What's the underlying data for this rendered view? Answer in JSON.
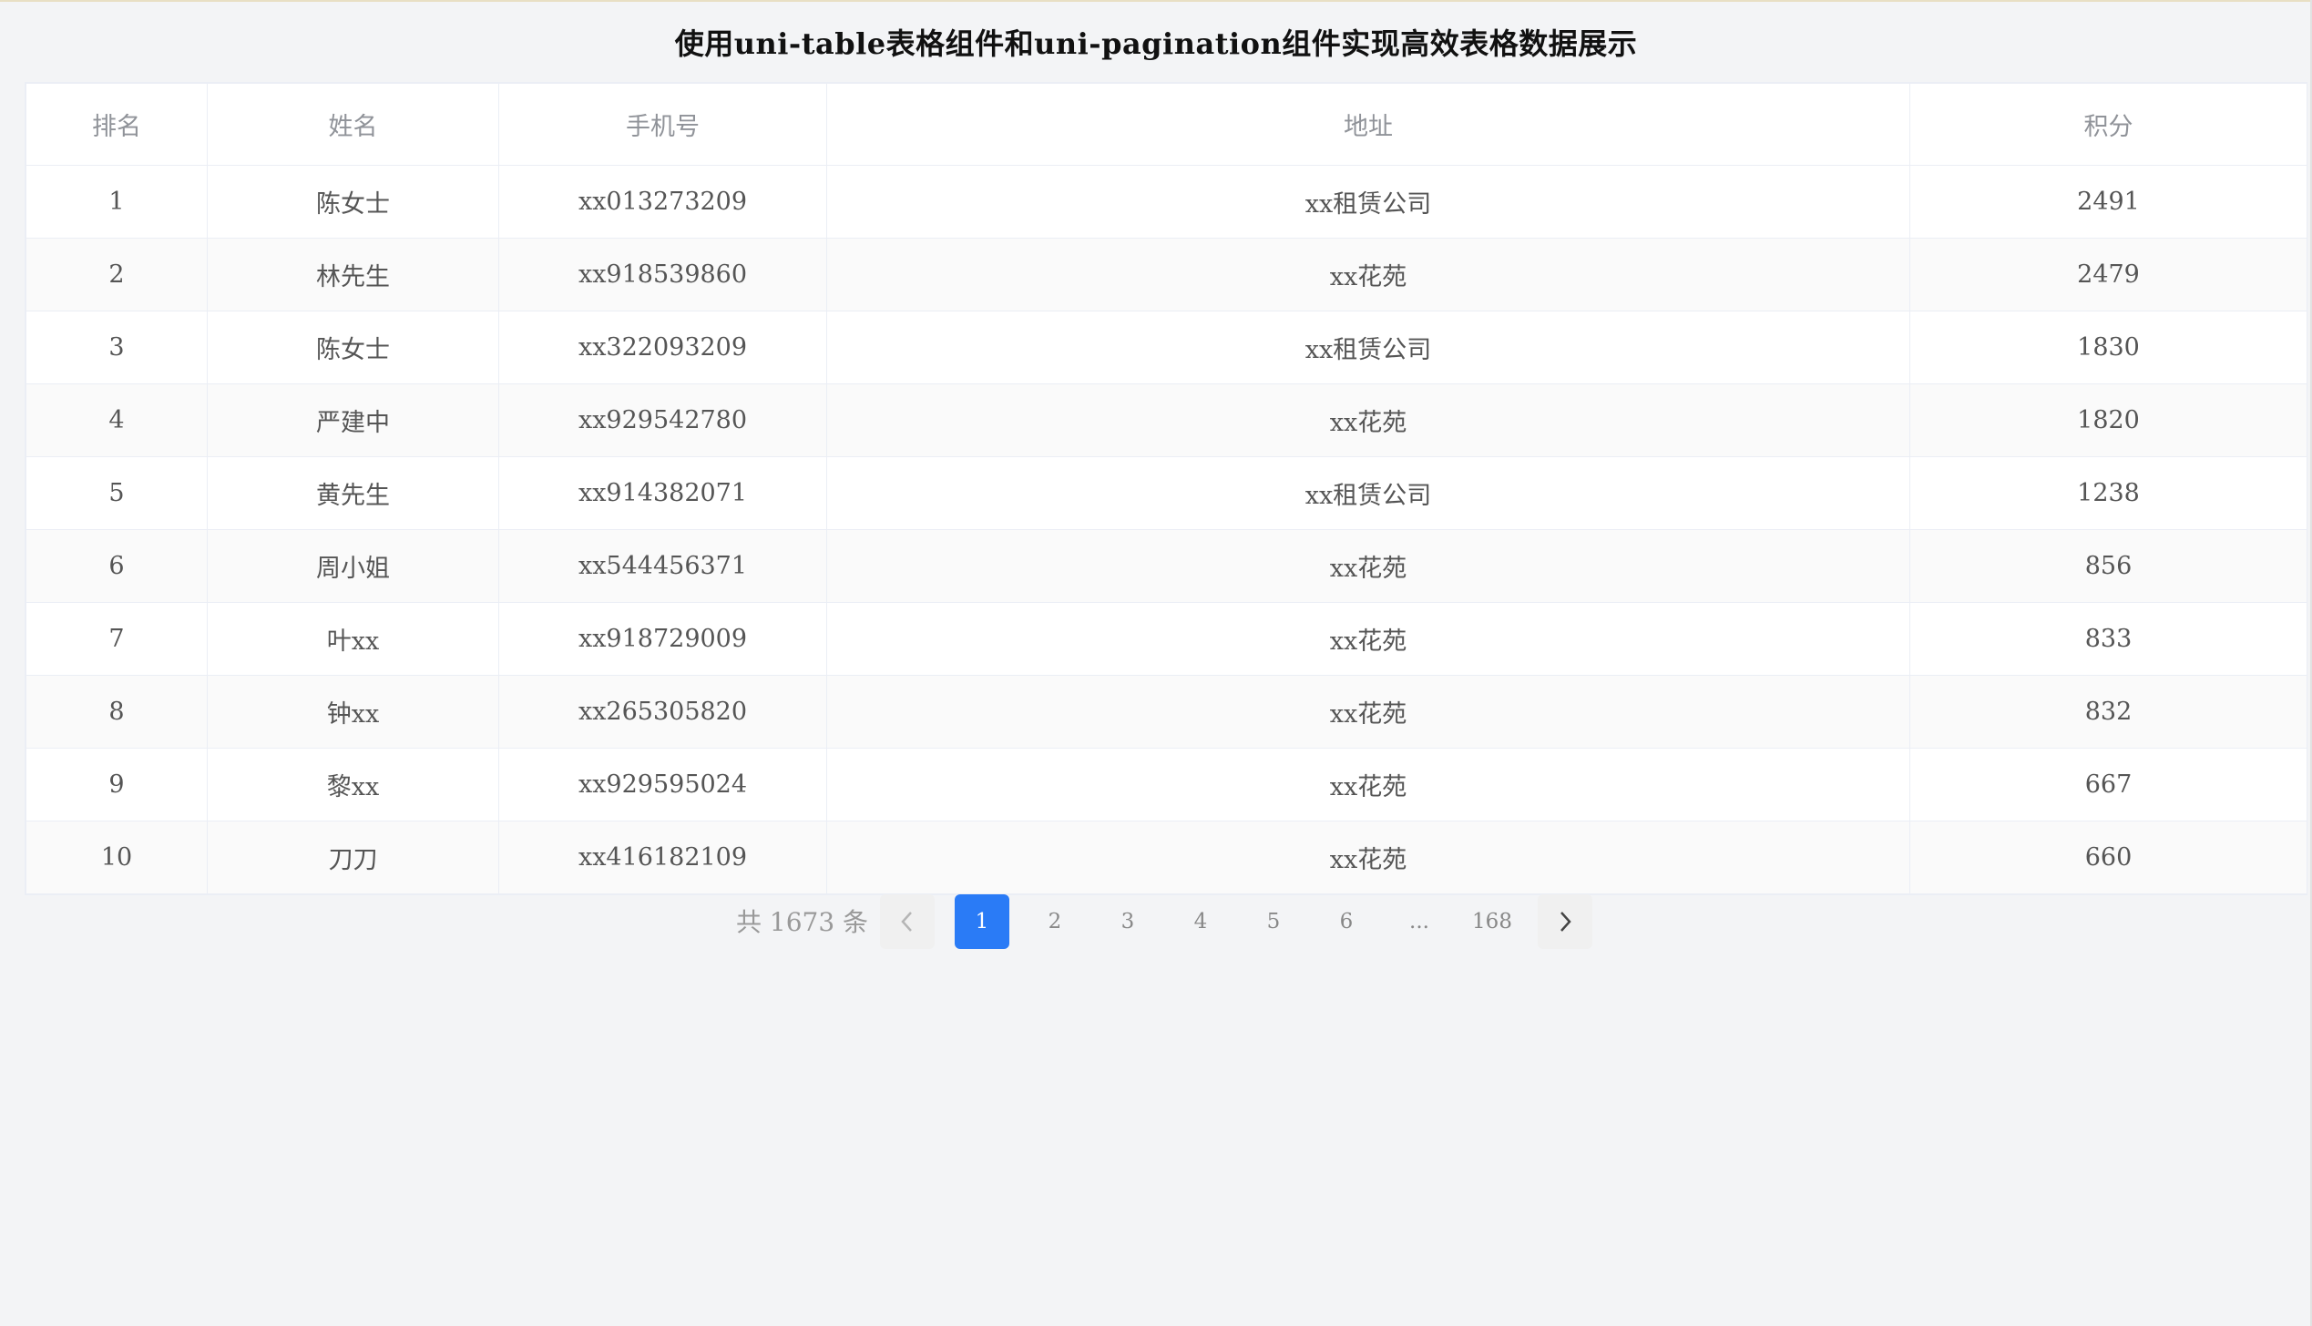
{
  "title": "使用uni-table表格组件和uni-pagination组件实现高效表格数据展示",
  "table": {
    "columns": [
      "排名",
      "姓名",
      "手机号",
      "地址",
      "积分"
    ],
    "rows": [
      {
        "rank": "1",
        "name": "陈女士",
        "phone": "xx013273209",
        "address": "xx租赁公司",
        "score": "2491"
      },
      {
        "rank": "2",
        "name": "林先生",
        "phone": "xx918539860",
        "address": "xx花苑",
        "score": "2479"
      },
      {
        "rank": "3",
        "name": "陈女士",
        "phone": "xx322093209",
        "address": "xx租赁公司",
        "score": "1830"
      },
      {
        "rank": "4",
        "name": "严建中",
        "phone": "xx929542780",
        "address": "xx花苑",
        "score": "1820"
      },
      {
        "rank": "5",
        "name": "黄先生",
        "phone": "xx914382071",
        "address": "xx租赁公司",
        "score": "1238"
      },
      {
        "rank": "6",
        "name": "周小姐",
        "phone": "xx544456371",
        "address": "xx花苑",
        "score": "856"
      },
      {
        "rank": "7",
        "name": "叶xx",
        "phone": "xx918729009",
        "address": "xx花苑",
        "score": "833"
      },
      {
        "rank": "8",
        "name": "钟xx",
        "phone": "xx265305820",
        "address": "xx花苑",
        "score": "832"
      },
      {
        "rank": "9",
        "name": "黎xx",
        "phone": "xx929595024",
        "address": "xx花苑",
        "score": "667"
      },
      {
        "rank": "10",
        "name": "刀刀",
        "phone": "xx416182109",
        "address": "xx花苑",
        "score": "660"
      }
    ]
  },
  "pagination": {
    "total_label": "共 1673 条",
    "prev_icon": "chevron-left-icon",
    "next_icon": "chevron-right-icon",
    "pages": [
      "1",
      "2",
      "3",
      "4",
      "5",
      "6",
      "...",
      "168"
    ],
    "current": "1"
  },
  "colors": {
    "accent": "#2a7bf6",
    "background": "#f3f4f6",
    "stripe": "#fafafa"
  }
}
